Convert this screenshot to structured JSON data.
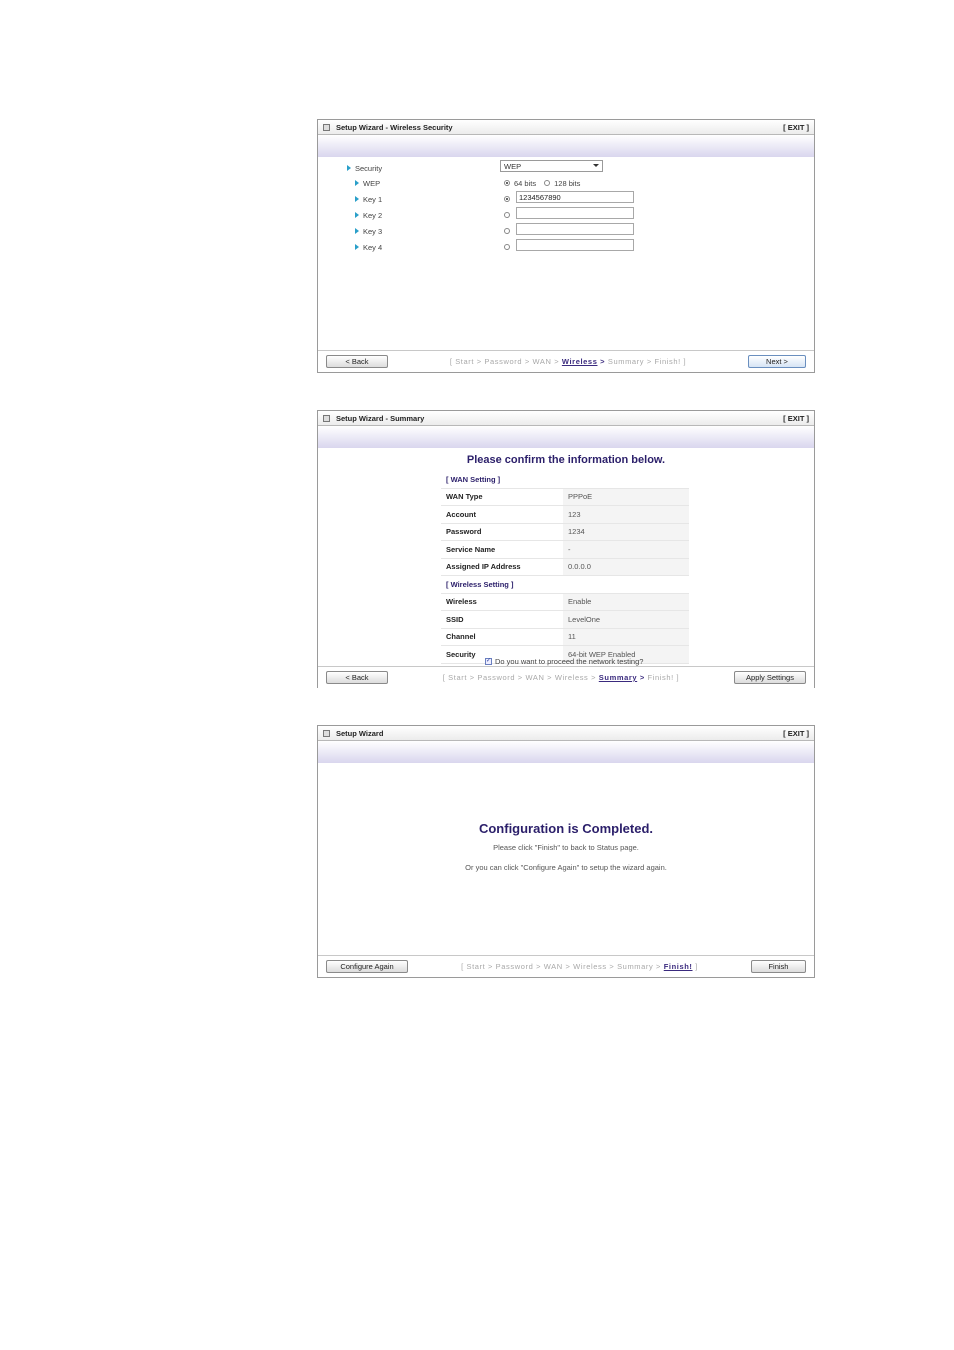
{
  "common": {
    "exit": "[ EXIT ]",
    "crumbs": [
      "Start",
      "Password",
      "WAN",
      "Wireless",
      "Summary",
      "Finish!"
    ],
    "crumb_open": "[",
    "crumb_close": "]",
    "crumb_sep": ">"
  },
  "panel1": {
    "title": "Setup Wizard - Wireless Security",
    "labels": {
      "security": "Security",
      "wep": "WEP",
      "key1": "Key 1",
      "key2": "Key 2",
      "key3": "Key 3",
      "key4": "Key 4"
    },
    "security_value": "WEP",
    "bits_64": "64 bits",
    "bits_128": "128 bits",
    "key1_value": "1234567890",
    "key2_value": "",
    "key3_value": "",
    "key4_value": "",
    "back": "< Back",
    "next": "Next >",
    "current_step": "Wireless"
  },
  "panel2": {
    "title": "Setup Wizard - Summary",
    "heading": "Please confirm the information below.",
    "wan_section": "[ WAN Setting ]",
    "wireless_section": "[ Wireless Setting ]",
    "wan_rows": [
      {
        "k": "WAN Type",
        "v": "PPPoE"
      },
      {
        "k": "Account",
        "v": "123"
      },
      {
        "k": "Password",
        "v": "1234"
      },
      {
        "k": "Service Name",
        "v": "-"
      },
      {
        "k": "Assigned IP Address",
        "v": "0.0.0.0"
      }
    ],
    "wireless_rows": [
      {
        "k": "Wireless",
        "v": "Enable"
      },
      {
        "k": "SSID",
        "v": "LevelOne"
      },
      {
        "k": "Channel",
        "v": "11"
      },
      {
        "k": "Security",
        "v": "64-bit WEP Enabled"
      }
    ],
    "test_checkbox": "Do you want to proceed the network testing?",
    "back": "< Back",
    "apply": "Apply Settings",
    "current_step": "Summary"
  },
  "panel3": {
    "title": "Setup Wizard",
    "heading": "Configuration is Completed.",
    "line1": "Please click \"Finish\" to back to Status page.",
    "line2": "Or you can click \"Configure Again\" to setup the wizard again.",
    "configure_again": "Configure Again",
    "finish": "Finish",
    "current_step": "Finish!"
  }
}
